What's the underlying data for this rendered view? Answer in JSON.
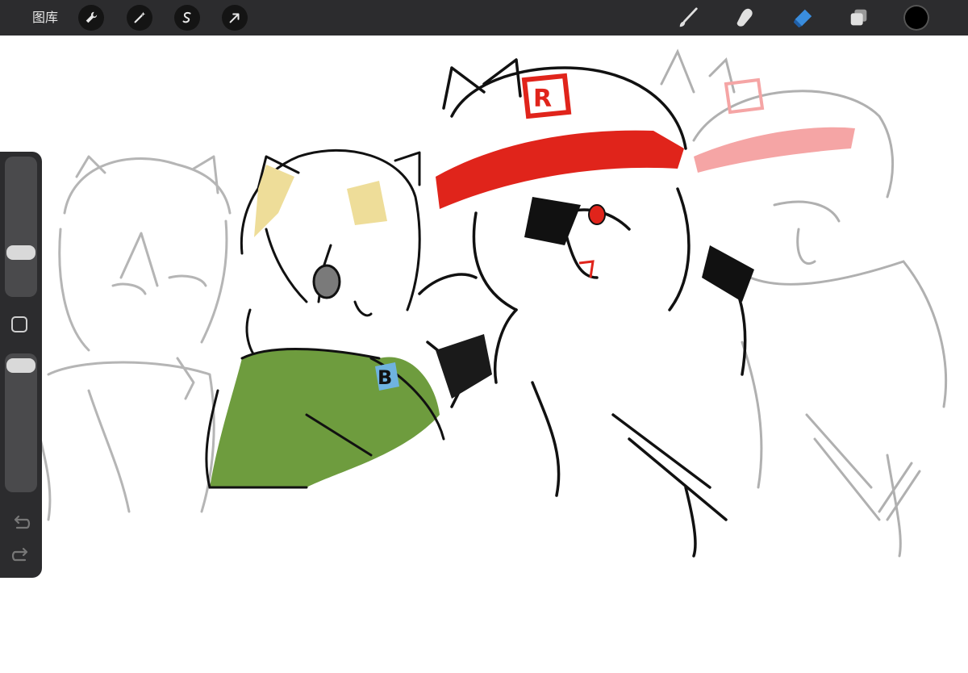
{
  "toolbar": {
    "gallery_label": "图库",
    "left_tools": [
      "wrench-icon",
      "magic-wand-icon",
      "selection-icon",
      "transform-arrow-icon"
    ],
    "right_tools": [
      "brush-icon",
      "smudge-icon",
      "eraser-icon",
      "layers-icon"
    ],
    "active_tool": "eraser-icon",
    "accent_color": "#3a8dde",
    "current_color": "#000000"
  },
  "sidebar": {
    "size_slider_value": 0.3,
    "opacity_slider_value": 1.0
  },
  "colors": {
    "toolbar_bg": "#2c2c2e",
    "cap_red": "#e0241b",
    "cape_green": "#6e9c3e",
    "hair_yellow": "#eedd99",
    "badge_blue": "#6fb3e0",
    "sketch_gray": "#9a9a9a"
  }
}
